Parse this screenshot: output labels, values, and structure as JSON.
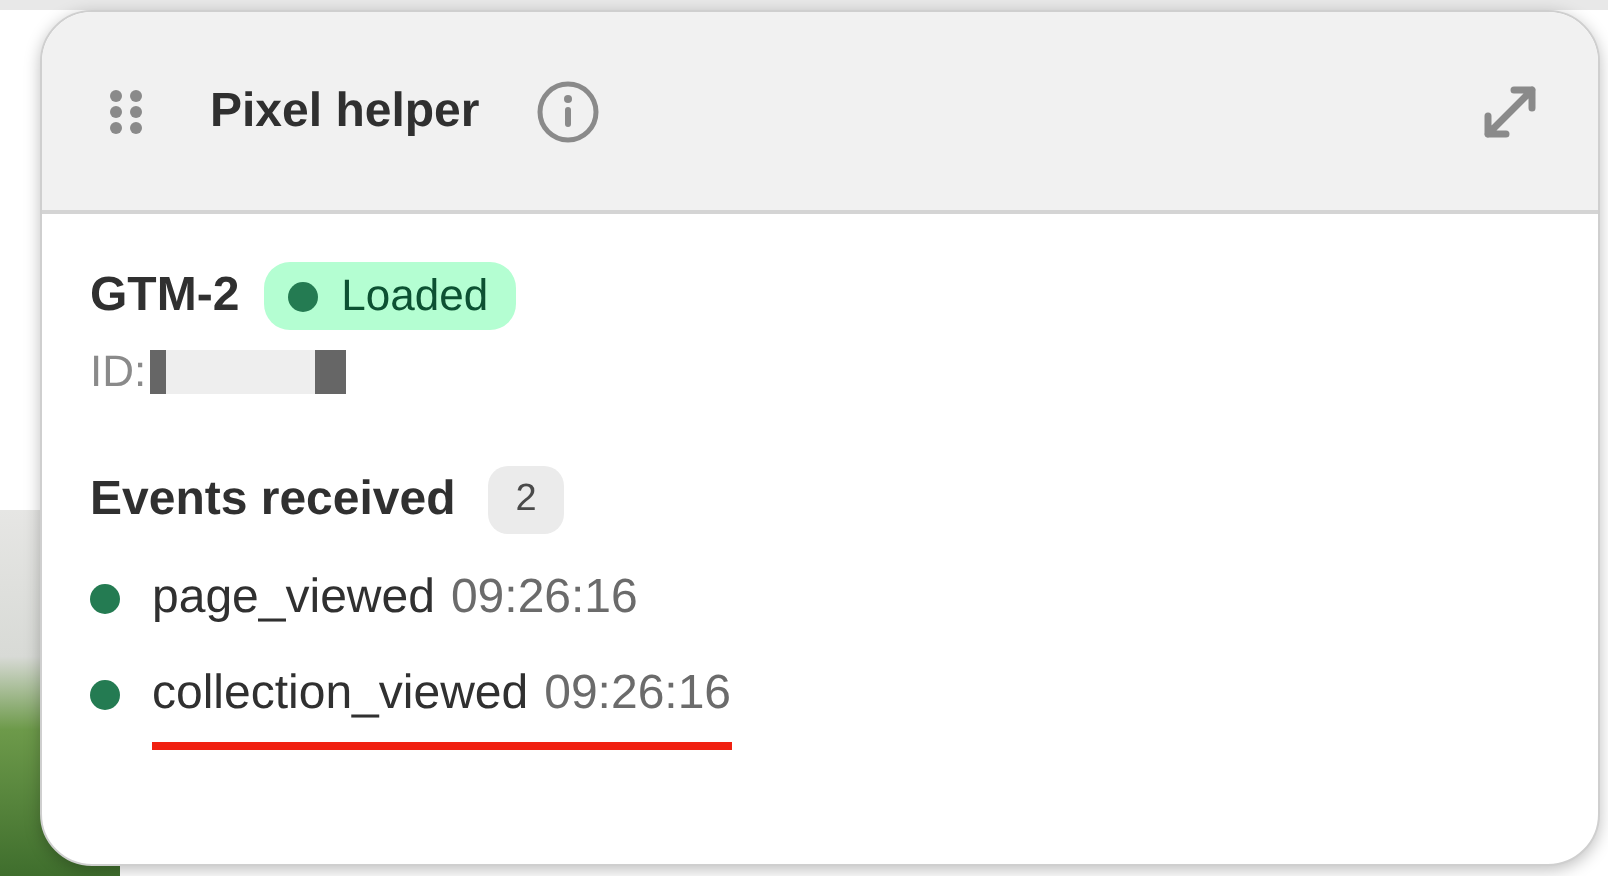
{
  "panel": {
    "title": "Pixel helper"
  },
  "pixel": {
    "name": "GTM-2",
    "status": "Loaded",
    "id_label": "ID:"
  },
  "events": {
    "heading": "Events received",
    "count": "2",
    "items": [
      {
        "name": "page_viewed",
        "time": "09:26:16",
        "color": "#247b52",
        "underlined": false
      },
      {
        "name": "collection_viewed",
        "time": "09:26:16",
        "color": "#247b52",
        "underlined": true
      }
    ]
  }
}
